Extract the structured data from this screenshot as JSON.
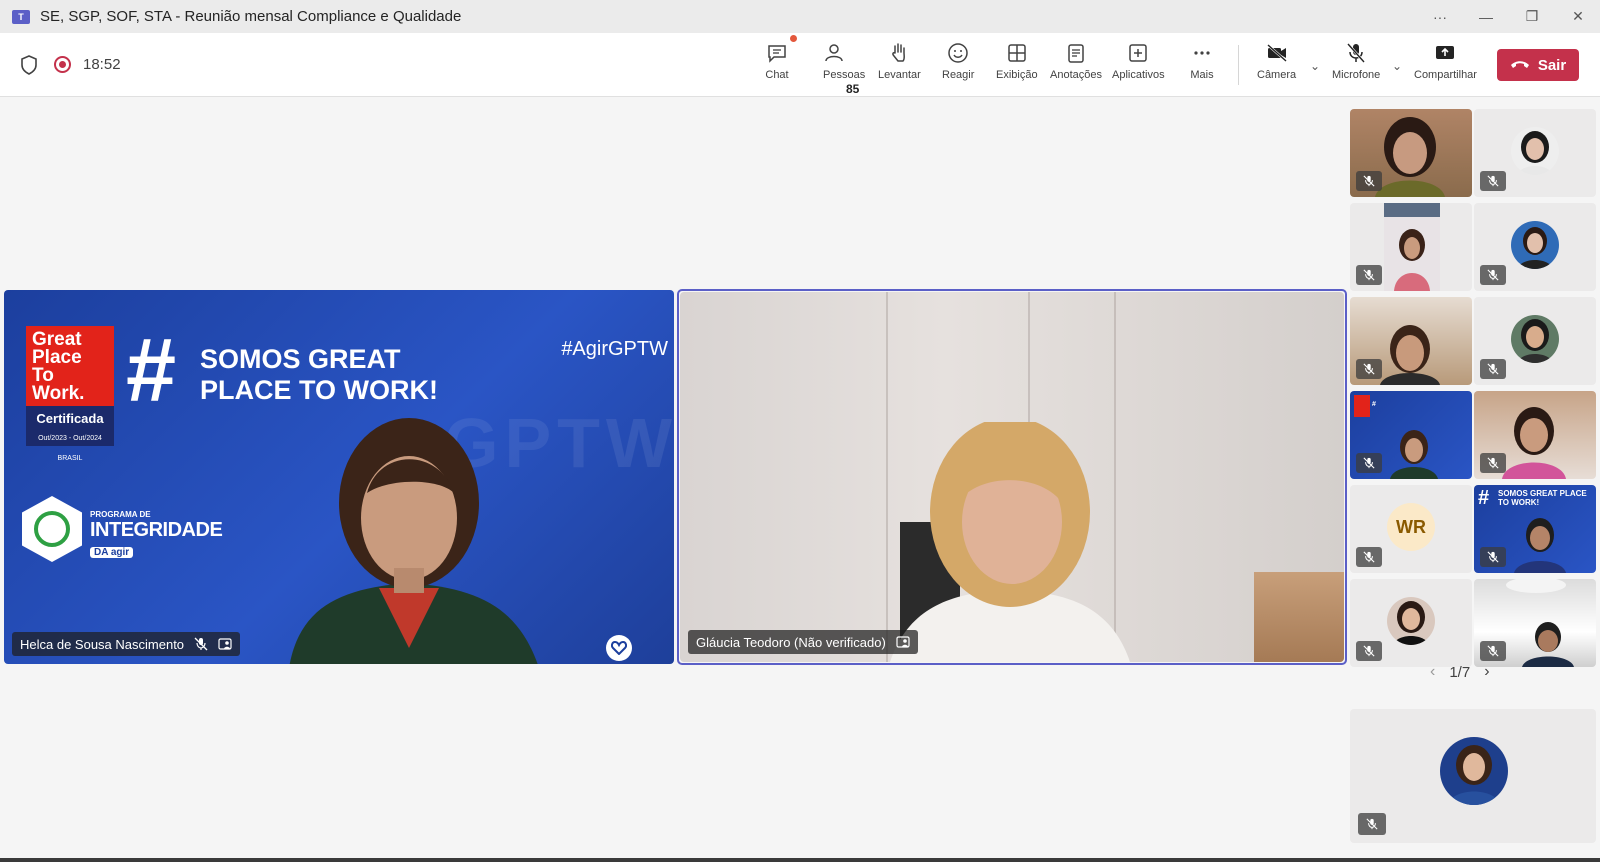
{
  "window": {
    "title": "SE, SGP, SOF, STA - Reunião mensal Compliance e Qualidade",
    "app_logo": "T",
    "controls": [
      "more-icon",
      "minimize-icon",
      "restore-icon",
      "close-icon"
    ]
  },
  "toolbar": {
    "timer": "18:52",
    "chat_label": "Chat",
    "people_label": "Pessoas",
    "people_count": "85",
    "raise_label": "Levantar",
    "react_label": "Reagir",
    "view_label": "Exibição",
    "notes_label": "Anotações",
    "apps_label": "Aplicativos",
    "more_label": "Mais",
    "camera_label": "Câmera",
    "mic_label": "Microfone",
    "share_label": "Compartilhar",
    "leave_label": "Sair",
    "colors": {
      "leave": "#c4314b",
      "accent": "#5b5fc7",
      "notification": "#e3573b"
    }
  },
  "stage": {
    "tile_a": {
      "name": "Helca de Sousa Nascimento",
      "background": {
        "gptw_lines": [
          "Great",
          "Place",
          "To",
          "Work."
        ],
        "certificada": "Certificada",
        "cert_dates": "Out/2023 - Out/2024",
        "cert_country": "BRASIL",
        "hash": "#",
        "headline_1": "SOMOS GREAT",
        "headline_2": "PLACE TO WORK!",
        "hashtag": "#AgirGPTW",
        "program_small": "PROGRAMA DE",
        "program_big": "INTEGRIDADE",
        "program_da": "DA",
        "program_agir": "agir",
        "watermark": "GPTW"
      }
    },
    "tile_b": {
      "name": "Gláucia Teodoro (Não verificado)"
    },
    "thumbnails": [
      {
        "kind": "video"
      },
      {
        "kind": "avatar"
      },
      {
        "kind": "video"
      },
      {
        "kind": "avatar"
      },
      {
        "kind": "video"
      },
      {
        "kind": "avatar"
      },
      {
        "kind": "video-bg"
      },
      {
        "kind": "video"
      },
      {
        "kind": "initials",
        "initials": "WR"
      },
      {
        "kind": "video-bg",
        "headline": "SOMOS GREAT PLACE TO WORK!"
      },
      {
        "kind": "avatar"
      },
      {
        "kind": "video"
      }
    ],
    "thumb_bg_headline": "SOMOS GREAT PLACE TO WORK!",
    "pager": "1/7"
  }
}
